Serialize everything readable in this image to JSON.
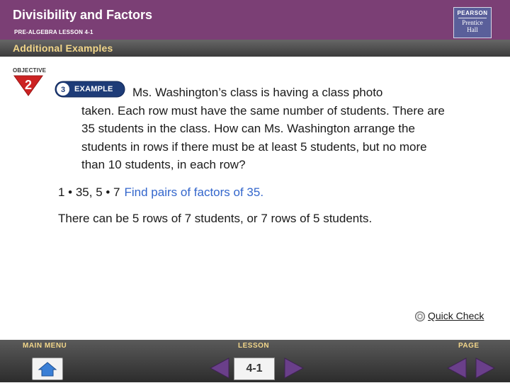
{
  "header": {
    "title": "Divisibility and Factors",
    "subtitle": "PRE-ALGEBRA LESSON 4-1",
    "logo_top": "PEARSON",
    "logo_name_line1": "Prentice",
    "logo_name_line2": "Hall"
  },
  "subbar": {
    "label": "Additional Examples"
  },
  "objective": {
    "label": "OBJECTIVE",
    "number": "2"
  },
  "example": {
    "number": "3",
    "label": "EXAMPLE"
  },
  "problem": {
    "line1": "Ms. Washington’s class is having a class photo",
    "rest": "taken. Each row must have the same number of students. There are 35 students in the class. How can Ms. Washington arrange the students in rows if there must be at least 5 students, but no more than 10 students, in each row?"
  },
  "step1": {
    "math": "1 • 35, 5 • 7",
    "hint": "Find pairs of factors of 35."
  },
  "answer": "There can be 5 rows of 7 students, or 7 rows of 5 students.",
  "quick_check": "Quick Check",
  "footer": {
    "main_menu": "MAIN MENU",
    "lesson": "LESSON",
    "page": "PAGE",
    "lesson_value": "4-1"
  },
  "colors": {
    "header_bg": "#7b3f75",
    "subbar_text": "#f2d68a",
    "objective_red": "#cc2222",
    "example_blue": "#1e3c78",
    "hint_blue": "#3366cc",
    "arrow_purple": "#6a3f8a"
  }
}
